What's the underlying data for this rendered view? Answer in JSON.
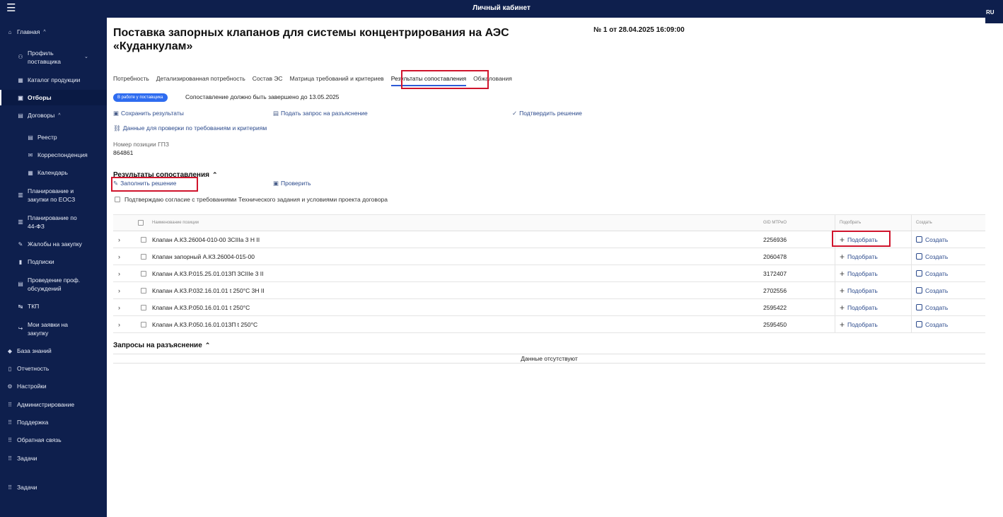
{
  "header": {
    "title": "Личный кабинет",
    "menu_icon": "hamburger-icon",
    "lang": "RU"
  },
  "sidebar": {
    "items": [
      {
        "label": "Главная",
        "icon": "home-icon",
        "chevron": "^"
      },
      {
        "label": "Профиль поставщика",
        "icon": "user-icon",
        "chevron": "⌄"
      },
      {
        "label": "Каталог продукции",
        "icon": "catalog-icon"
      },
      {
        "label": "Отборы",
        "icon": "selection-icon"
      },
      {
        "label": "Договоры",
        "icon": "contract-icon",
        "chevron": "^"
      },
      {
        "label": "Реестр",
        "icon": "registry-icon"
      },
      {
        "label": "Корреспонденция",
        "icon": "mail-icon"
      },
      {
        "label": "Календарь",
        "icon": "calendar-icon"
      },
      {
        "label": "Планирование и закупки по ЕОСЗ",
        "icon": "plan-icon"
      },
      {
        "label": "Планирование по 44-ФЗ",
        "icon": "plan44-icon"
      },
      {
        "label": "Жалобы на закупку",
        "icon": "complaint-icon"
      },
      {
        "label": "Подписки",
        "icon": "subscription-icon"
      },
      {
        "label": "Проведение проф. обсуждений",
        "icon": "discussion-icon"
      },
      {
        "label": "ТКП",
        "icon": "tkp-icon"
      },
      {
        "label": "Мои заявки на закупку",
        "icon": "requests-icon"
      },
      {
        "label": "База знаний",
        "icon": "knowledge-icon"
      },
      {
        "label": "Отчетность",
        "icon": "report-icon"
      },
      {
        "label": "Настройки",
        "icon": "settings-icon"
      },
      {
        "label": "Администрирование",
        "icon": "admin-icon"
      },
      {
        "label": "Поддержка",
        "icon": "support-icon"
      },
      {
        "label": "Обратная связь",
        "icon": "feedback-icon"
      },
      {
        "label": "Задачи",
        "icon": "tasks-icon"
      },
      {
        "label": "Задачи",
        "icon": "tasks-icon"
      }
    ]
  },
  "page": {
    "title": "Поставка запорных клапанов для системы концентрирования на АЭС «Куданкулам»",
    "doc_number": "№ 1 от 28.04.2025 16:09:00",
    "tabs": [
      "Потребность",
      "Детализированная потребность",
      "Состав ЭС",
      "Матрица требований и критериев",
      "Результаты сопоставления",
      "Обжалования"
    ],
    "active_tab": "Результаты сопоставления",
    "status_badge": "В работе у поставщика",
    "deadline_text": "Сопоставление должно быть завершено до 13.05.2025",
    "actions": {
      "save": "Сохранить результаты",
      "request": "Подать запрос на разъяснение",
      "confirm": "Подтвердить решение",
      "check_data": "Данные для проверки по требованиям и критериям"
    },
    "gpz_label": "Номер позиции ГПЗ",
    "gpz_value": "864861"
  },
  "results": {
    "title": "Результаты сопоставления",
    "fill_decision": "Заполнить решение",
    "verify": "Проверить",
    "agree_text": "Подтверждаю согласие с требованиями Технического задания и условиями проекта договора",
    "columns": {
      "name": "Наименование позиции",
      "gid": "GID МТРиО",
      "pick": "Подобрать",
      "create": "Создать"
    },
    "pick_label": "Подобрать",
    "create_label": "Создать",
    "rows": [
      {
        "name": "Клапан А.КЗ.26004-010-00 3СIIIа 3 Н II",
        "gid": "2256936"
      },
      {
        "name": "Клапан запорный А.КЗ.26004-015-00",
        "gid": "2060478"
      },
      {
        "name": "Клапан А.КЗ.Р.015.25.01.013П 3СIIIе 3 II",
        "gid": "3172407"
      },
      {
        "name": "Клапан А.КЗ.Р.032.16.01.01 t 250°С 3Н II",
        "gid": "2702556"
      },
      {
        "name": "Клапан А.КЗ.Р.050.16.01.01 t 250°С",
        "gid": "2595422"
      },
      {
        "name": "Клапан А.КЗ.Р.050.16.01.013П t 250°С",
        "gid": "2595450"
      }
    ]
  },
  "requests": {
    "title": "Запросы на разъяснение",
    "empty": "Данные отсутствуют"
  }
}
